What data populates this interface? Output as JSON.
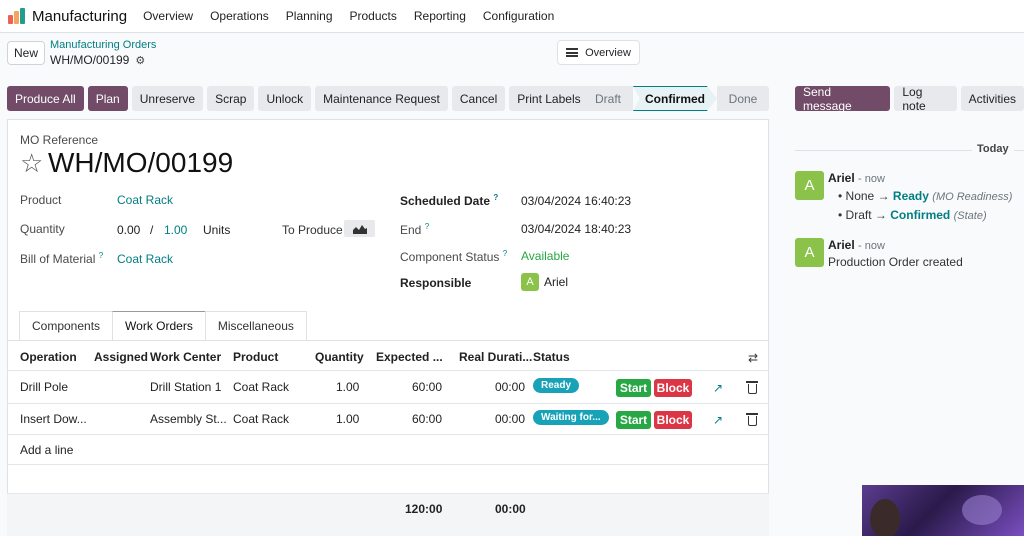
{
  "app": {
    "name": "Manufacturing",
    "menu": [
      "Overview",
      "Operations",
      "Planning",
      "Products",
      "Reporting",
      "Configuration"
    ]
  },
  "control": {
    "new_label": "New",
    "breadcrumb_parent": "Manufacturing Orders",
    "breadcrumb_current": "WH/MO/00199",
    "overview_label": "Overview"
  },
  "actions": [
    "Produce All",
    "Plan",
    "Unreserve",
    "Scrap",
    "Unlock",
    "Maintenance Request",
    "Cancel",
    "Print Labels"
  ],
  "stages": [
    "Draft",
    "Confirmed",
    "Done"
  ],
  "chatter_buttons": [
    "Send message",
    "Log note",
    "Activities"
  ],
  "form": {
    "ref_label": "MO Reference",
    "title": "WH/MO/00199",
    "product_label": "Product",
    "product": "Coat Rack",
    "quantity_label": "Quantity",
    "qty_done": "0.00",
    "qty_sep": "/",
    "qty_total": "1.00",
    "qty_unit": "Units",
    "to_produce_label": "To Produce",
    "bom_label": "Bill of Material",
    "bom": "Coat Rack",
    "scheduled_label": "Scheduled Date",
    "scheduled": "03/04/2024 16:40:23",
    "end_label": "End",
    "end": "03/04/2024 18:40:23",
    "component_status_label": "Component Status",
    "component_status": "Available",
    "responsible_label": "Responsible",
    "responsible": "Ariel",
    "responsible_initial": "A",
    "help_mark": "?"
  },
  "tabs": [
    "Components",
    "Work Orders",
    "Miscellaneous"
  ],
  "table": {
    "headers": [
      "Operation",
      "Assigned",
      "Work Center",
      "Product",
      "Quantity",
      "Expected ...",
      "Real Durati...",
      "Status"
    ],
    "rows": [
      {
        "operation": "Drill Pole",
        "assigned": "",
        "work_center": "Drill Station 1",
        "product": "Coat Rack",
        "quantity": "1.00",
        "expected": "60:00",
        "real": "00:00",
        "status": "Ready",
        "start": "Start",
        "block": "Block"
      },
      {
        "operation": "Insert Dow...",
        "assigned": "",
        "work_center": "Assembly St...",
        "product": "Coat Rack",
        "quantity": "1.00",
        "expected": "60:00",
        "real": "00:00",
        "status": "Waiting for...",
        "start": "Start",
        "block": "Block"
      }
    ],
    "add_line": "Add a line",
    "total_expected": "120:00",
    "total_real": "00:00"
  },
  "chatter": {
    "day": "Today",
    "messages": [
      {
        "initial": "A",
        "author": "Ariel",
        "date": "- now",
        "changes": [
          {
            "from": "None",
            "arrow": "→",
            "to": "Ready",
            "field": "(MO Readiness)"
          },
          {
            "from": "Draft",
            "arrow": "→",
            "to": "Confirmed",
            "field": "(State)"
          }
        ]
      },
      {
        "initial": "A",
        "author": "Ariel",
        "date": "- now",
        "body": "Production Order created"
      }
    ]
  },
  "colors": {
    "primary": "#714b67",
    "link": "#017e84",
    "success": "#28a745",
    "danger": "#dc3545",
    "badge": "#17a2b8"
  }
}
